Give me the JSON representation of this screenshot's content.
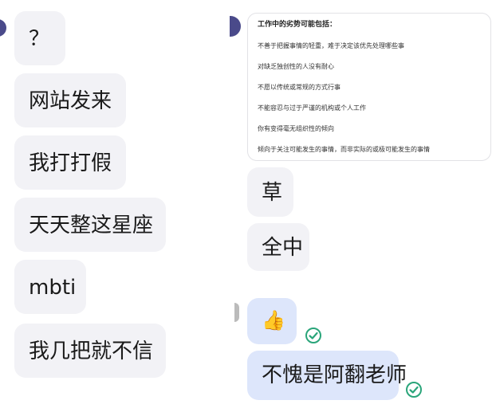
{
  "left_panel": {
    "messages": [
      {
        "text": "？"
      },
      {
        "text": "网站发来"
      },
      {
        "text": "我打打假"
      },
      {
        "text": "天天整这星座"
      },
      {
        "text": "mbti"
      },
      {
        "text": "我几把就不信"
      }
    ]
  },
  "right_panel": {
    "card": {
      "title": "工作中的劣势可能包括：",
      "lines": [
        "不善于把握事情的轻重，难于决定该优先处理哪些事",
        "对缺乏独创性的人没有耐心",
        "不愿以传统或常规的方式行事",
        "不能容忍与过于严谨的机构或个人工作",
        "你有变得毫无组织性的倾向",
        "倾向于关注可能发生的事情，而非实际的或极可能发生的事情"
      ]
    },
    "messages": [
      {
        "text": "草"
      },
      {
        "text": "全中"
      }
    ],
    "sent": {
      "emoji": "👍",
      "text": "不愧是阿翻老师"
    }
  },
  "colors": {
    "incoming_bubble": "#f2f2f6",
    "outgoing_bubble": "#dde6fb",
    "check_green": "#2aa57a"
  }
}
